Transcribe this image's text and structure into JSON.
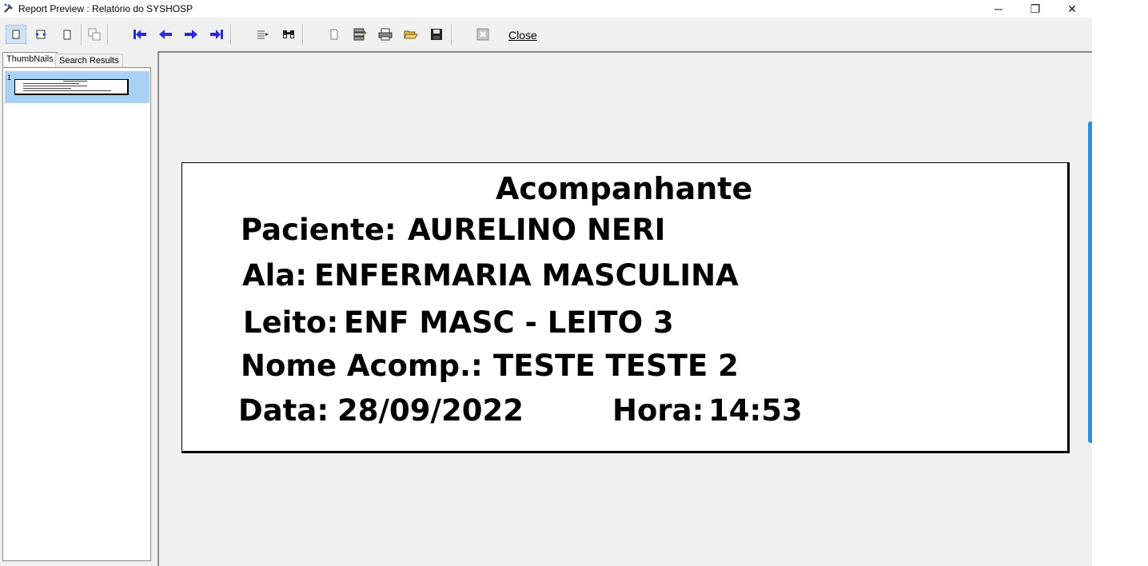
{
  "window": {
    "title": "Report Preview : Relatório do SYSHOSP",
    "controls": {
      "minimize": "─",
      "restore": "❐",
      "close": "✕"
    }
  },
  "toolbar": {
    "close_label": "Close",
    "icons": [
      "single-page-icon",
      "two-page-icon",
      "page-width-icon",
      "copy-icon",
      "first-page-icon",
      "previous-page-icon",
      "next-page-icon",
      "last-page-icon",
      "page-list-icon",
      "find-icon",
      "blank-page-icon",
      "export-icon",
      "print-icon",
      "open-icon",
      "save-icon",
      "exit-icon"
    ],
    "accent": "#2a2ad6"
  },
  "left_panel": {
    "tabs": [
      {
        "label": "ThumbNails",
        "active": true
      },
      {
        "label": "Search Results",
        "active": false
      }
    ],
    "thumbnails": [
      {
        "number": "1",
        "selected": true
      }
    ]
  },
  "report": {
    "title": "Acompanhante",
    "paciente_label": "Paciente:",
    "paciente_value": "AURELINO NERI",
    "ala_label": "Ala:",
    "ala_value": "ENFERMARIA MASCULINA",
    "leito_label": "Leito:",
    "leito_value": "ENF MASC - LEITO 3",
    "acomp_label": "Nome Acomp.:",
    "acomp_value": "TESTE TESTE 2",
    "data_label": "Data:",
    "data_value": "28/09/2022",
    "hora_label": "Hora:",
    "hora_value": "14:53"
  }
}
